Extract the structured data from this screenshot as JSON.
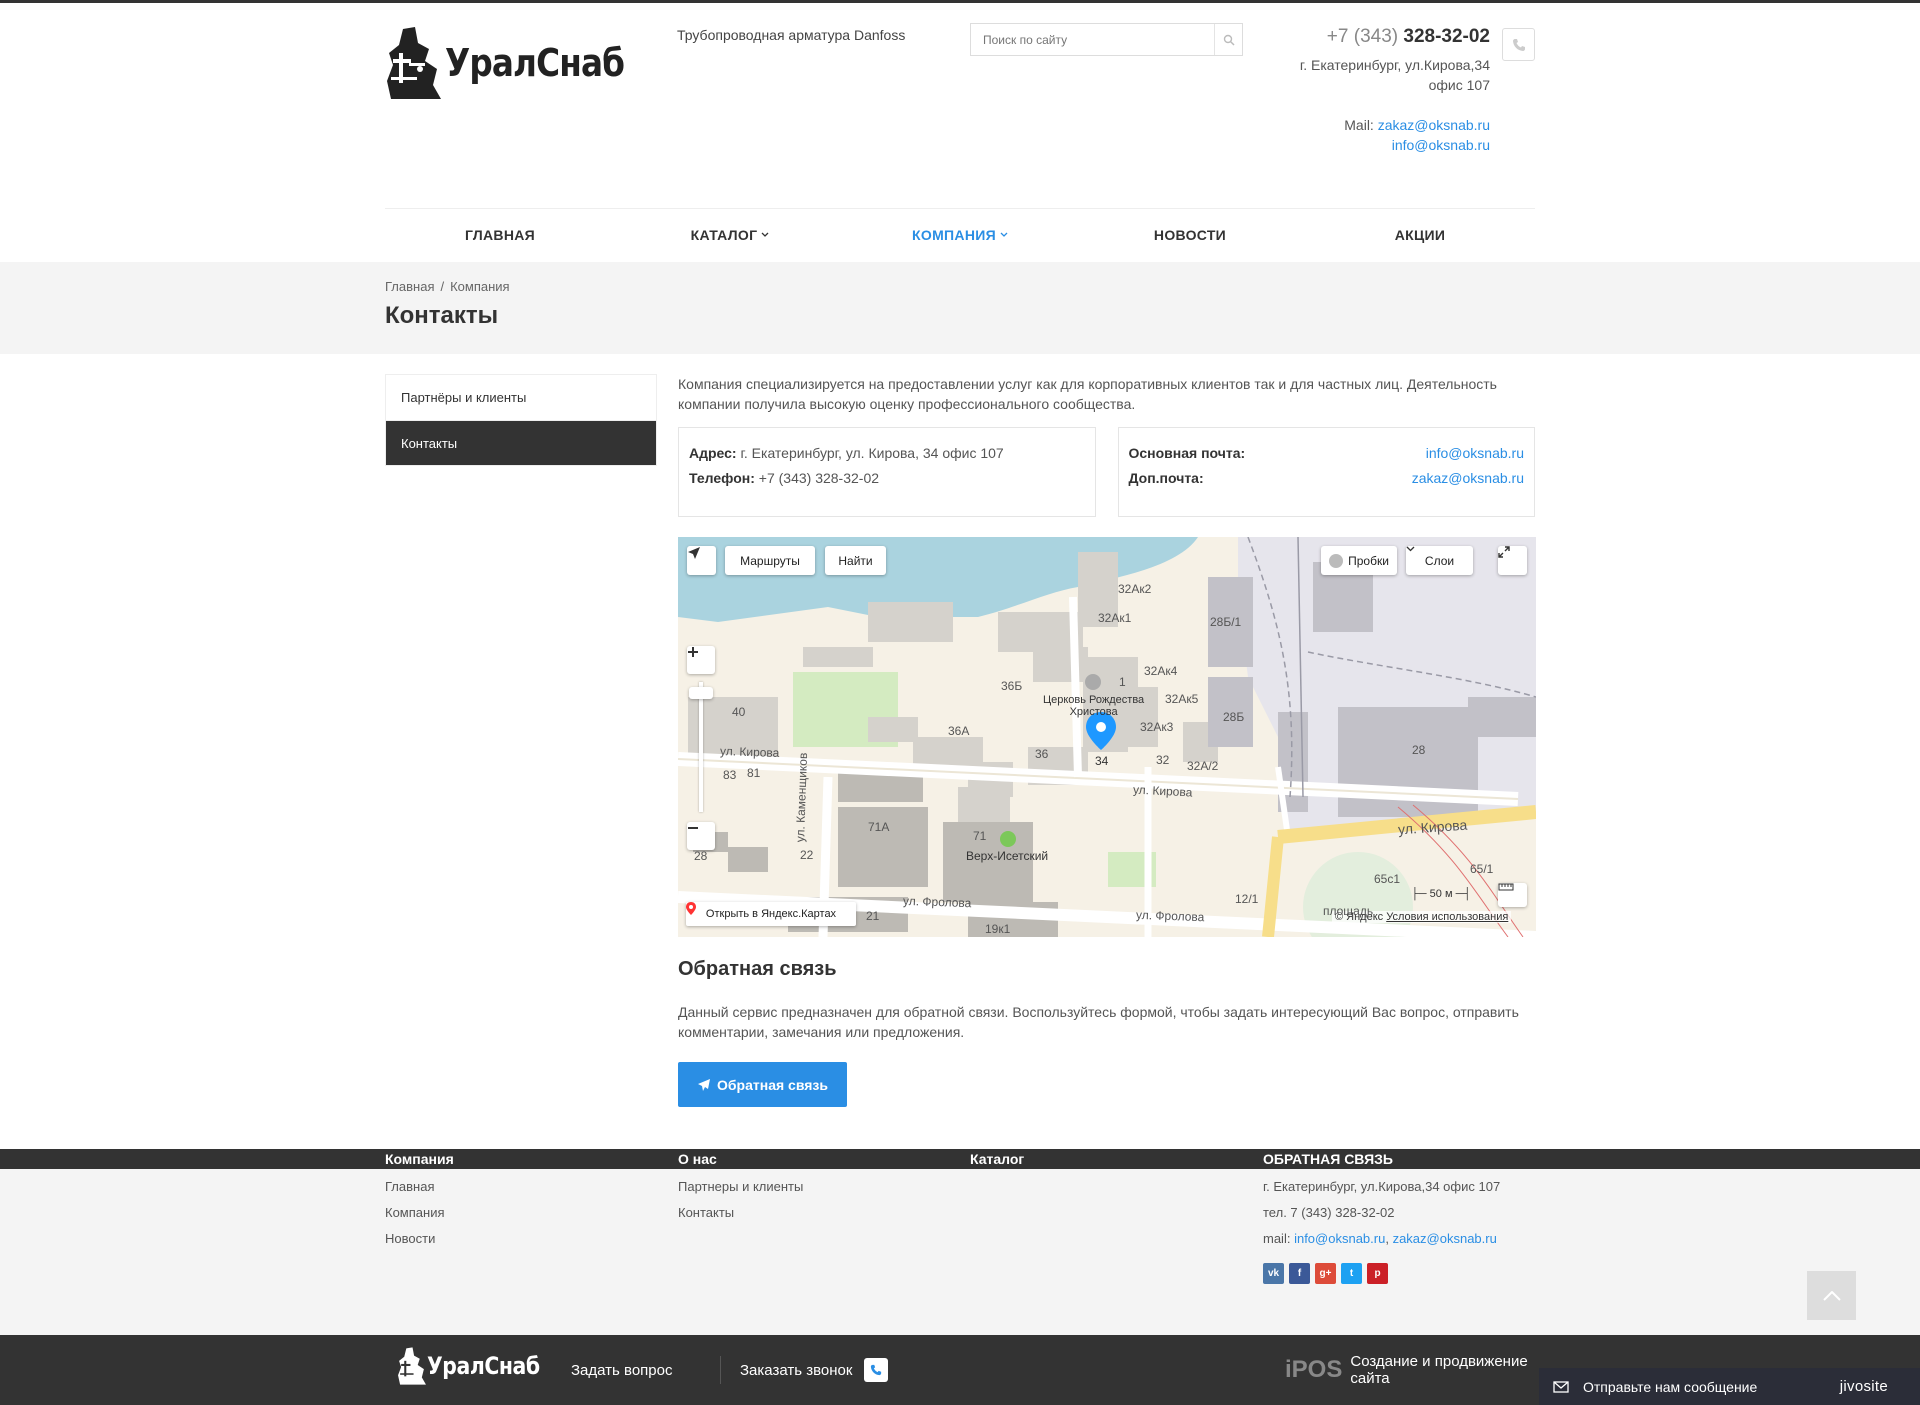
{
  "header": {
    "logo_text": "УралСнаб",
    "slogan": "Трубопроводная арматура Danfoss",
    "search_placeholder": "Поиск по сайту",
    "phone_code": "+7 (343)",
    "phone_number": "328-32-02",
    "address_line1": "г. Екатеринбург, ул.Кирова,34",
    "address_line2": "офис 107",
    "mail_label": "Mail:",
    "mail1": "zakaz@oksnab.ru",
    "mail2": "info@oksnab.ru"
  },
  "nav": [
    {
      "label": "ГЛАВНАЯ"
    },
    {
      "label": "КАТАЛОГ"
    },
    {
      "label": "КОМПАНИЯ"
    },
    {
      "label": "НОВОСТИ"
    },
    {
      "label": "АКЦИИ"
    }
  ],
  "breadcrumbs": [
    "Главная",
    "/",
    "Компания"
  ],
  "page_title": "Контакты",
  "sidebar": [
    {
      "label": "Партнёры и клиенты"
    },
    {
      "label": "Контакты"
    }
  ],
  "intro": "Компания специализируется на предоставлении услуг как для корпоративных клиентов так и для частных лиц. Деятельность компании получила высокую оценку профессионального сообщества.",
  "contact_card": {
    "address_label": "Адрес:",
    "address": "г. Екатеринбург, ул. Кирова, 34 офис 107",
    "phone_label": "Телефон:",
    "phone": "+7 (343) 328-32-02"
  },
  "mail_card": {
    "main_label": "Основная почта:",
    "main": "info@oksnab.ru",
    "extra_label": "Доп.почта:",
    "extra": "zakaz@oksnab.ru"
  },
  "map": {
    "routes": "Маршруты",
    "find": "Найти",
    "traffic": "Пробки",
    "layers": "Слои",
    "open_link": "Открыть в Яндекс.Картах",
    "copyright": "© Яндекс",
    "terms": "Условия использования",
    "scale": "50 м",
    "church": "Церковь Рождества",
    "church2": "Христова",
    "street1": "ул. Кирова",
    "street2": "ул. Кирова",
    "street3": "ул. Кирова",
    "street4": "ул. Фролова",
    "street5": "ул. Фролова",
    "street6": "ул. Каменщиков",
    "place": "Верх-Исетский",
    "square": "площадь",
    "labels": [
      "32Ак2",
      "32Ак1",
      "28Б/1",
      "32Ак4",
      "36Б",
      "1",
      "32Ак5",
      "28Б",
      "36А",
      "32Ак3",
      "36",
      "34",
      "32",
      "32А/2",
      "40",
      "83",
      "81",
      "28",
      "71А",
      "71",
      "22",
      "28",
      "65с1",
      "65/1",
      "21",
      "19к1",
      "12/1"
    ]
  },
  "feedback": {
    "title": "Обратная связь",
    "text": "Данный сервис предназначен для обратной связи. Воспользуйтесь формой, чтобы задать интересующий Вас вопрос, отправить комментарии, замечания или предложения.",
    "button": "Обратная связь"
  },
  "footer": {
    "col1_title": "Компания",
    "col1": [
      "Главная",
      "Компания",
      "Новости"
    ],
    "col2_title": "О нас",
    "col2": [
      "Партнеры и клиенты",
      "Контакты"
    ],
    "col3_title": "Каталог",
    "col4_title": "ОБРАТНАЯ СВЯЗЬ",
    "address": "г. Екатеринбург, ул.Кирова,34 офис 107",
    "phone": "тел. 7 (343) 328-32-02",
    "mail_label": "mail:",
    "mail1": "info@oksnab.ru",
    "comma": ",",
    "mail2": "zakaz@oksnab.ru",
    "socials": [
      "vk",
      "f",
      "g+",
      "t",
      "p"
    ]
  },
  "bottom": {
    "logo_text": "УралСнаб",
    "ask": "Задать вопрос",
    "call": "Заказать звонок",
    "ipos_mark": "iPOS",
    "ipos_text": "Создание и продвижение сайта"
  },
  "jivo": {
    "text": "Отправьте нам сообщение",
    "brand": "jivosite"
  },
  "colors": {
    "accent": "#2a8ee4",
    "dark": "#333333",
    "band": "#f4f4f4"
  }
}
